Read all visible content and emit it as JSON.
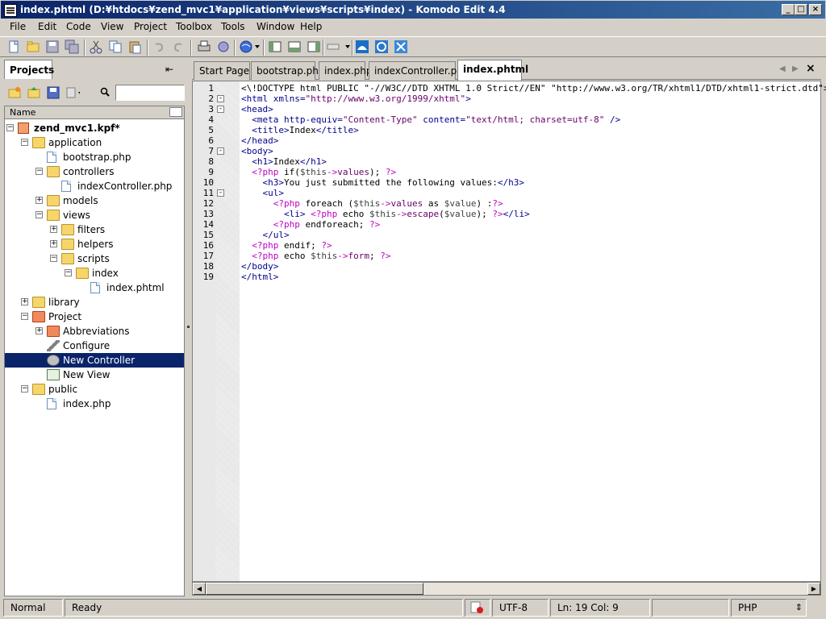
{
  "window": {
    "title": "index.phtml (D:¥htdocs¥zend_mvc1¥application¥views¥scripts¥index) - Komodo Edit 4.4",
    "minimize": "_",
    "maximize": "□",
    "close": "×"
  },
  "menu": [
    "File",
    "Edit",
    "Code",
    "View",
    "Project",
    "Toolbox",
    "Tools",
    "Window",
    "Help"
  ],
  "left_pane": {
    "tab_label": "Projects",
    "pin_glyph": "⇤",
    "search_placeholder": "",
    "column_header": "Name",
    "tree": [
      {
        "label": "zend_mvc1.kpf*",
        "level": 0,
        "icon": "project-file-icon",
        "expander": "-",
        "bold": true
      },
      {
        "label": "application",
        "level": 1,
        "icon": "folder-icon",
        "expander": "-"
      },
      {
        "label": "bootstrap.php",
        "level": 2,
        "icon": "file-icon",
        "expander": ""
      },
      {
        "label": "controllers",
        "level": 2,
        "icon": "folder-icon",
        "expander": "-"
      },
      {
        "label": "indexController.php",
        "level": 3,
        "icon": "file-icon",
        "expander": ""
      },
      {
        "label": "models",
        "level": 2,
        "icon": "folder-icon",
        "expander": "+"
      },
      {
        "label": "views",
        "level": 2,
        "icon": "folder-icon",
        "expander": "-"
      },
      {
        "label": "filters",
        "level": 3,
        "icon": "folder-icon",
        "expander": "+"
      },
      {
        "label": "helpers",
        "level": 3,
        "icon": "folder-icon",
        "expander": "+"
      },
      {
        "label": "scripts",
        "level": 3,
        "icon": "folder-icon",
        "expander": "-"
      },
      {
        "label": "index",
        "level": 4,
        "icon": "folder-icon",
        "expander": "-"
      },
      {
        "label": "index.phtml",
        "level": 5,
        "icon": "file-icon",
        "expander": ""
      },
      {
        "label": "library",
        "level": 1,
        "icon": "folder-icon",
        "expander": "+"
      },
      {
        "label": "Project",
        "level": 1,
        "icon": "folder-red-icon",
        "expander": "-"
      },
      {
        "label": "Abbreviations",
        "level": 2,
        "icon": "folder-red-icon",
        "expander": "+"
      },
      {
        "label": "Configure",
        "level": 2,
        "icon": "wrench-icon",
        "expander": ""
      },
      {
        "label": "New Controller",
        "level": 2,
        "icon": "gear-icon",
        "expander": "",
        "selected": true
      },
      {
        "label": "New View",
        "level": 2,
        "icon": "view-icon",
        "expander": ""
      },
      {
        "label": "public",
        "level": 1,
        "icon": "folder-icon",
        "expander": "-"
      },
      {
        "label": "index.php",
        "level": 2,
        "icon": "file-icon",
        "expander": ""
      }
    ]
  },
  "editor": {
    "tabs": [
      {
        "label": "Start Page",
        "active": false
      },
      {
        "label": "bootstrap.php",
        "active": false
      },
      {
        "label": "index.php",
        "active": false
      },
      {
        "label": "indexController.php",
        "active": false
      },
      {
        "label": "index.phtml",
        "active": true
      }
    ],
    "close_glyph": "×",
    "lines": [
      {
        "n": "1",
        "fold": "",
        "tokens": [
          [
            "txt",
            "<\\!DOCTYPE html PUBLIC \"-//W3C//DTD XHTML 1.0 Strict//EN\" \"http://www.w3.org/TR/xhtml1/DTD/xhtml1-strict.dtd\">"
          ]
        ]
      },
      {
        "n": "2",
        "fold": "-",
        "tokens": [
          [
            "tag",
            "<html "
          ],
          [
            "attr",
            "xmlns="
          ],
          [
            "str",
            "\"http://www.w3.org/1999/xhtml\""
          ],
          [
            "tag",
            ">"
          ]
        ]
      },
      {
        "n": "3",
        "fold": "-",
        "tokens": [
          [
            "tag",
            "<head>"
          ]
        ]
      },
      {
        "n": "4",
        "fold": "",
        "tokens": [
          [
            "txt",
            "  "
          ],
          [
            "tag",
            "<meta "
          ],
          [
            "attr",
            "http-equiv="
          ],
          [
            "str",
            "\"Content-Type\""
          ],
          [
            "attr",
            " content="
          ],
          [
            "str",
            "\"text/html; charset=utf-8\""
          ],
          [
            "tag",
            " />"
          ]
        ]
      },
      {
        "n": "5",
        "fold": "",
        "tokens": [
          [
            "txt",
            "  "
          ],
          [
            "tag",
            "<title>"
          ],
          [
            "txt",
            "Index"
          ],
          [
            "tag",
            "</title>"
          ]
        ]
      },
      {
        "n": "6",
        "fold": "",
        "tokens": [
          [
            "tag",
            "</head>"
          ]
        ]
      },
      {
        "n": "7",
        "fold": "-",
        "tokens": [
          [
            "tag",
            "<body>"
          ]
        ]
      },
      {
        "n": "8",
        "fold": "",
        "tokens": [
          [
            "txt",
            "  "
          ],
          [
            "tag",
            "<h1>"
          ],
          [
            "txt",
            "Index"
          ],
          [
            "tag",
            "</h1>"
          ]
        ]
      },
      {
        "n": "9",
        "fold": "",
        "tokens": [
          [
            "txt",
            "  "
          ],
          [
            "php",
            "<?php "
          ],
          [
            "op",
            "if("
          ],
          [
            "var",
            "$this"
          ],
          [
            "php",
            "->"
          ],
          [
            "str",
            "values"
          ],
          [
            "op",
            "); "
          ],
          [
            "php",
            "?>"
          ]
        ]
      },
      {
        "n": "10",
        "fold": "",
        "tokens": [
          [
            "txt",
            "    "
          ],
          [
            "tag",
            "<h3>"
          ],
          [
            "txt",
            "You just submitted the following values:"
          ],
          [
            "tag",
            "</h3>"
          ]
        ]
      },
      {
        "n": "11",
        "fold": "-",
        "tokens": [
          [
            "txt",
            "    "
          ],
          [
            "tag",
            "<ul>"
          ]
        ]
      },
      {
        "n": "12",
        "fold": "",
        "tokens": [
          [
            "txt",
            "      "
          ],
          [
            "php",
            "<?php "
          ],
          [
            "op",
            "foreach ("
          ],
          [
            "var",
            "$this"
          ],
          [
            "php",
            "->"
          ],
          [
            "str",
            "values"
          ],
          [
            "op",
            " as "
          ],
          [
            "var",
            "$value"
          ],
          [
            "op",
            ") :"
          ],
          [
            "php",
            "?>"
          ]
        ]
      },
      {
        "n": "13",
        "fold": "",
        "tokens": [
          [
            "txt",
            "        "
          ],
          [
            "tag",
            "<li> "
          ],
          [
            "php",
            "<?php "
          ],
          [
            "op",
            "echo "
          ],
          [
            "var",
            "$this"
          ],
          [
            "php",
            "->"
          ],
          [
            "str",
            "escape"
          ],
          [
            "op",
            "("
          ],
          [
            "var",
            "$value"
          ],
          [
            "op",
            "); "
          ],
          [
            "php",
            "?>"
          ],
          [
            "tag",
            "</li>"
          ]
        ]
      },
      {
        "n": "14",
        "fold": "",
        "tokens": [
          [
            "txt",
            "      "
          ],
          [
            "php",
            "<?php "
          ],
          [
            "op",
            "endforeach; "
          ],
          [
            "php",
            "?>"
          ]
        ]
      },
      {
        "n": "15",
        "fold": "",
        "tokens": [
          [
            "txt",
            "    "
          ],
          [
            "tag",
            "</ul>"
          ]
        ]
      },
      {
        "n": "16",
        "fold": "",
        "tokens": [
          [
            "txt",
            "  "
          ],
          [
            "php",
            "<?php "
          ],
          [
            "op",
            "endif; "
          ],
          [
            "php",
            "?>"
          ]
        ]
      },
      {
        "n": "17",
        "fold": "",
        "tokens": [
          [
            "txt",
            "  "
          ],
          [
            "php",
            "<?php "
          ],
          [
            "op",
            "echo "
          ],
          [
            "var",
            "$this"
          ],
          [
            "php",
            "->"
          ],
          [
            "str",
            "form"
          ],
          [
            "op",
            "; "
          ],
          [
            "php",
            "?>"
          ]
        ]
      },
      {
        "n": "18",
        "fold": "",
        "tokens": [
          [
            "tag",
            "</body>"
          ]
        ]
      },
      {
        "n": "19",
        "fold": "",
        "tokens": [
          [
            "tag",
            "</html>"
          ]
        ]
      }
    ]
  },
  "status": {
    "mode": "Normal",
    "message": "Ready",
    "encoding": "UTF-8",
    "position": "Ln: 19 Col: 9",
    "language": "PHP",
    "language_arrow": "⇕"
  },
  "colors": {
    "titlebar_start": "#0a246a",
    "titlebar_end": "#3a6ea5",
    "selection": "#0a246a",
    "chrome": "#d4d0c8"
  }
}
